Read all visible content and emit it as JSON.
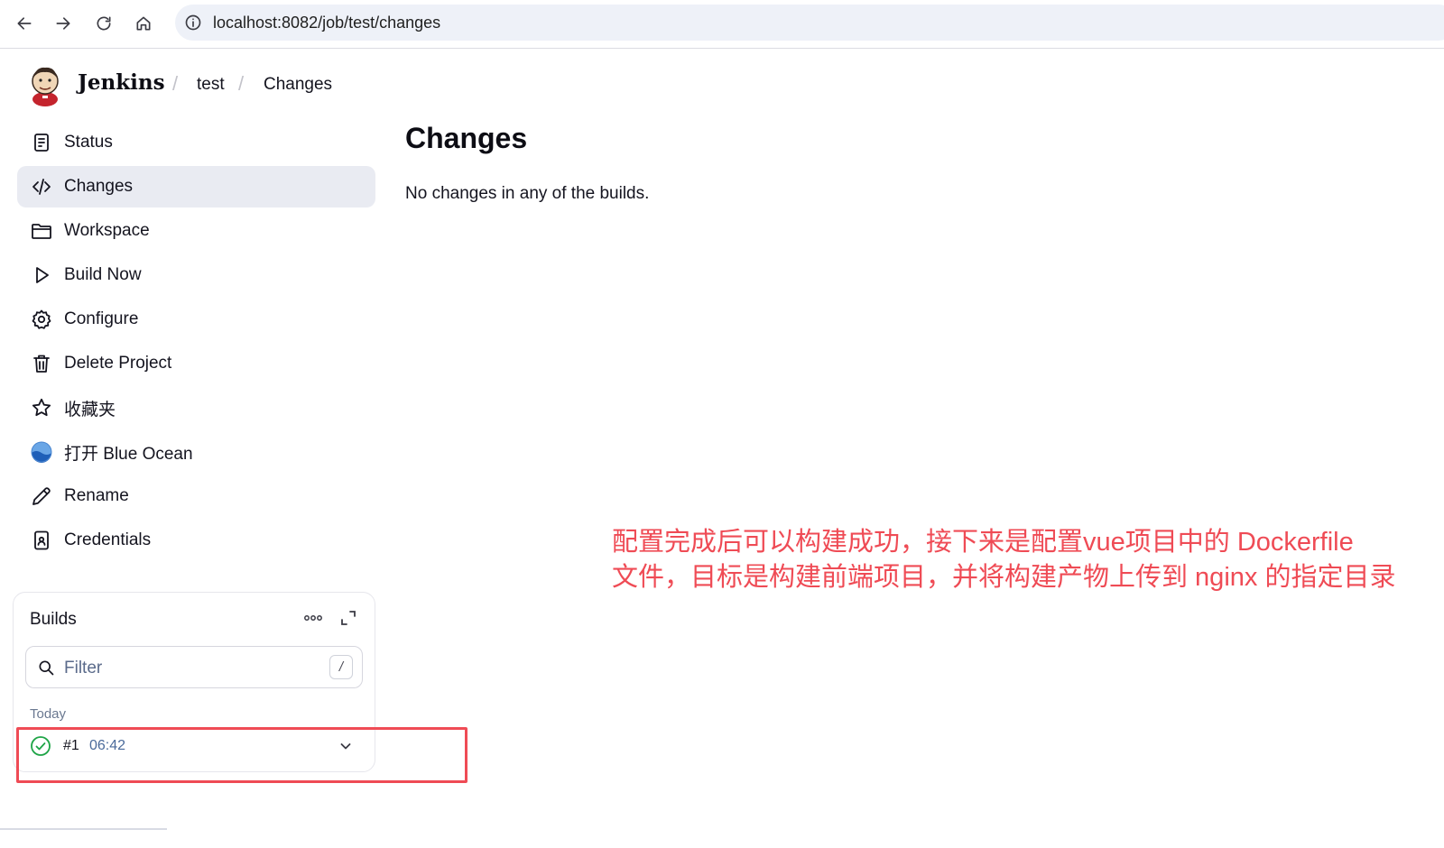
{
  "browser": {
    "url": "localhost:8082/job/test/changes"
  },
  "header": {
    "brand": "Jenkins",
    "breadcrumbs": [
      "test",
      "Changes"
    ]
  },
  "sidebar": {
    "items": [
      {
        "label": "Status",
        "icon": "document-icon"
      },
      {
        "label": "Changes",
        "icon": "code-icon",
        "active": true
      },
      {
        "label": "Workspace",
        "icon": "folder-icon"
      },
      {
        "label": "Build Now",
        "icon": "play-icon"
      },
      {
        "label": "Configure",
        "icon": "gear-icon"
      },
      {
        "label": "Delete Project",
        "icon": "trash-icon"
      },
      {
        "label": "收藏夹",
        "icon": "star-icon"
      },
      {
        "label": "打开 Blue Ocean",
        "icon": "blue-ocean-icon"
      },
      {
        "label": "Rename",
        "icon": "pencil-icon"
      },
      {
        "label": "Credentials",
        "icon": "credentials-icon"
      }
    ]
  },
  "builds": {
    "title": "Builds",
    "filter_placeholder": "Filter",
    "filter_shortcut": "/",
    "group_label": "Today",
    "rows": [
      {
        "number": "#1",
        "time": "06:42",
        "status": "success"
      }
    ]
  },
  "main": {
    "title": "Changes",
    "message": "No changes in any of the builds."
  },
  "annotation": {
    "line1": "配置完成后可以构建成功，接下来是配置vue项目中的 Dockerfile",
    "line2": "文件，目标是构建前端项目，并将构建产物上传到 nginx 的指定目录",
    "color": "#ef4b55"
  },
  "colors": {
    "accent_active_bg": "#e9ebf2",
    "success": "#1ea446",
    "highlight": "#ef4b55"
  }
}
